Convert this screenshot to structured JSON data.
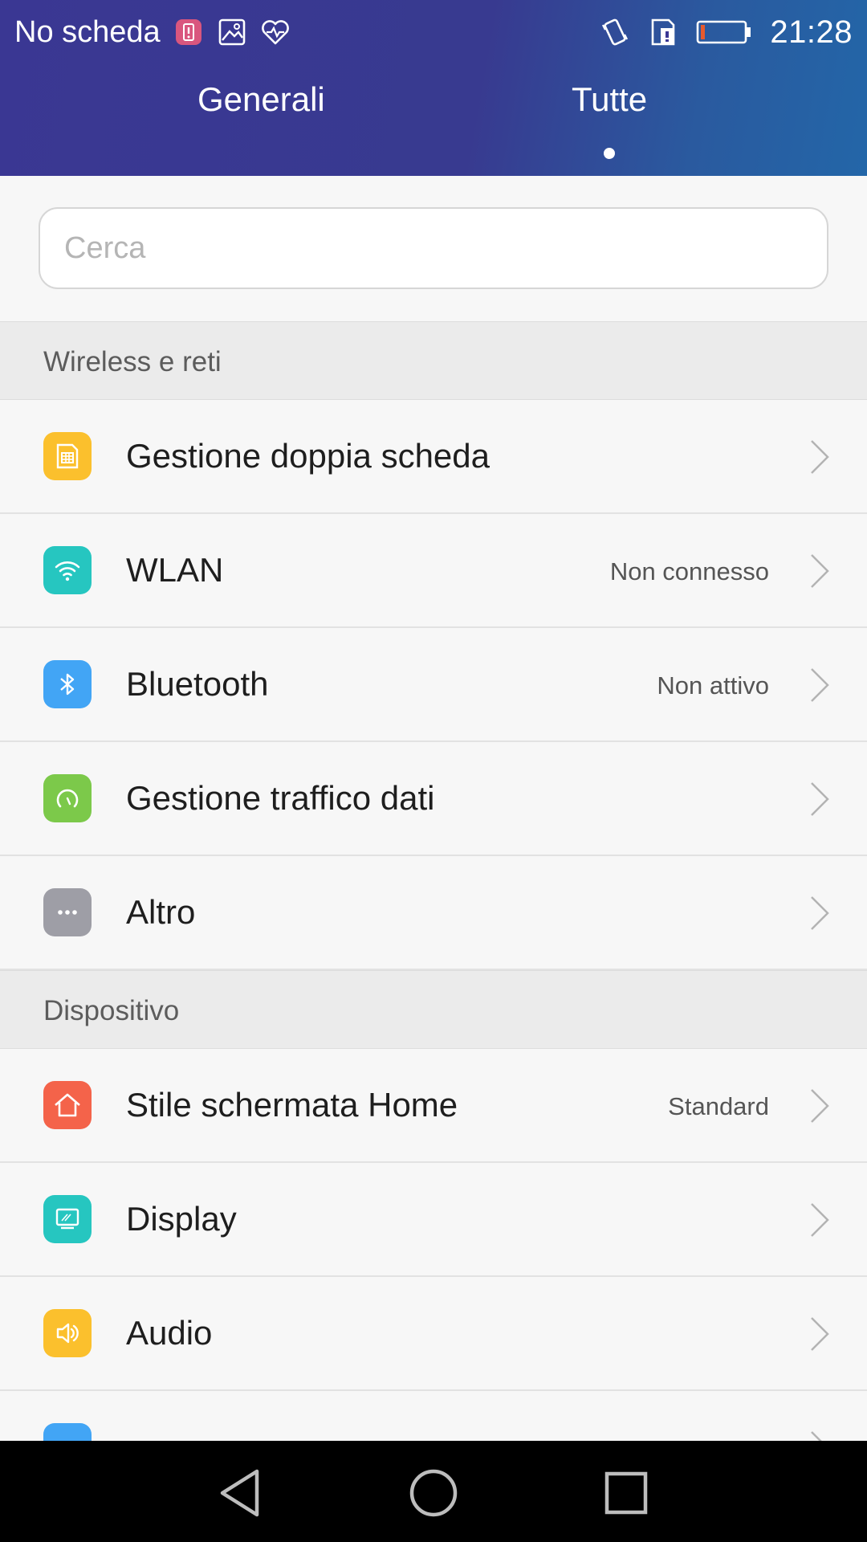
{
  "status": {
    "carrier": "No scheda",
    "time": "21:28",
    "icons_left": [
      "sim-alert-icon",
      "image-icon",
      "heart-monitor-icon"
    ],
    "icons_right": [
      "vibrate-icon",
      "sim-card-icon",
      "battery-low-icon"
    ]
  },
  "tabs": [
    {
      "label": "Generali",
      "active": false
    },
    {
      "label": "Tutte",
      "active": true
    }
  ],
  "search": {
    "placeholder": "Cerca",
    "value": ""
  },
  "sections": [
    {
      "title": "Wireless e reti",
      "items": [
        {
          "label": "Gestione doppia scheda",
          "value": "",
          "icon": "dual-sim-icon",
          "color": "#fbc02d"
        },
        {
          "label": "WLAN",
          "value": "Non connesso",
          "icon": "wifi-icon",
          "color": "#26c6c0"
        },
        {
          "label": "Bluetooth",
          "value": "Non attivo",
          "icon": "bluetooth-icon",
          "color": "#42a5f5"
        },
        {
          "label": "Gestione traffico dati",
          "value": "",
          "icon": "data-gauge-icon",
          "color": "#7cc94a"
        },
        {
          "label": "Altro",
          "value": "",
          "icon": "more-dots-icon",
          "color": "#9e9ea6"
        }
      ]
    },
    {
      "title": "Dispositivo",
      "items": [
        {
          "label": "Stile schermata Home",
          "value": "Standard",
          "icon": "home-icon",
          "color": "#f4634a"
        },
        {
          "label": "Display",
          "value": "",
          "icon": "display-icon",
          "color": "#26c6c0"
        },
        {
          "label": "Audio",
          "value": "",
          "icon": "speaker-icon",
          "color": "#fbc02d"
        }
      ]
    }
  ],
  "navbar": [
    "back-icon",
    "home-circle-icon",
    "recents-icon"
  ],
  "colors": {
    "header_start": "#3a3793",
    "header_end": "#2366a8",
    "background": "#f7f7f7",
    "section_bg": "#ebebeb"
  }
}
